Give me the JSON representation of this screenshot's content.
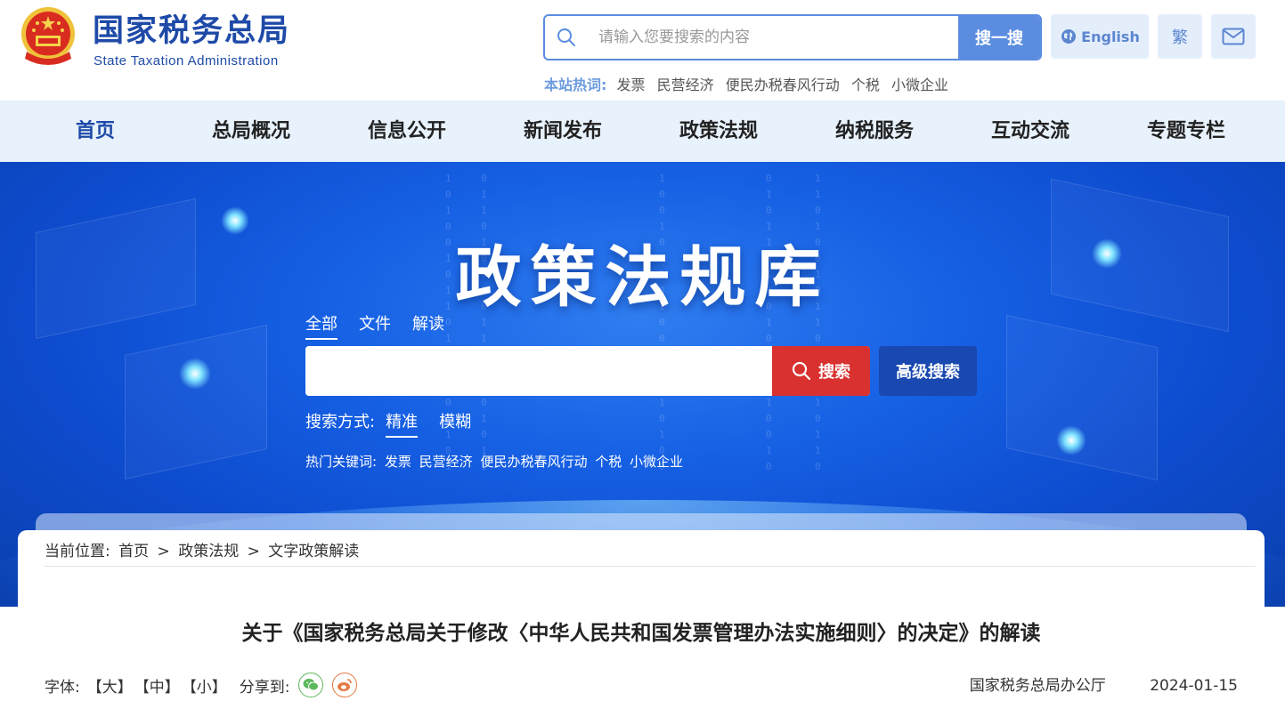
{
  "header": {
    "site_name_cn": "国家税务总局",
    "site_name_en": "State Taxation Administration",
    "search_placeholder": "请输入您要搜索的内容",
    "search_button": "搜一搜",
    "hot_label": "本站热词:",
    "hot_words": [
      "发票",
      "民营经济",
      "便民办税春风行动",
      "个税",
      "小微企业"
    ],
    "english_label": "English",
    "traditional_label": "繁"
  },
  "nav": {
    "items": [
      {
        "label": "首页",
        "active": true
      },
      {
        "label": "总局概况"
      },
      {
        "label": "信息公开"
      },
      {
        "label": "新闻发布"
      },
      {
        "label": "政策法规"
      },
      {
        "label": "纳税服务"
      },
      {
        "label": "互动交流"
      },
      {
        "label": "专题专栏"
      }
    ]
  },
  "banner": {
    "title": "政策法规库",
    "tabs": [
      {
        "label": "全部",
        "active": true
      },
      {
        "label": "文件"
      },
      {
        "label": "解读"
      }
    ],
    "search_button": "搜索",
    "advanced_button": "高级搜索",
    "mode_label": "搜索方式:",
    "modes": [
      {
        "label": "精准",
        "active": true
      },
      {
        "label": "模糊"
      }
    ],
    "hot_label": "热门关键词:",
    "hot_words": [
      "发票",
      "民营经济",
      "便民办税春风行动",
      "个税",
      "小微企业"
    ]
  },
  "content": {
    "breadcrumb_label": "当前位置:",
    "breadcrumb": [
      "首页",
      "政策法规",
      "文字政策解读"
    ],
    "breadcrumb_sep": ">",
    "title": "关于《国家税务总局关于修改〈中华人民共和国发票管理办法实施细则〉的决定》的解读",
    "font_label": "字体:",
    "font_sizes": [
      "【大】",
      "【中】",
      "【小】"
    ],
    "share_label": "分享到:",
    "source": "国家税务总局办公厅",
    "date": "2024-01-15"
  },
  "colors": {
    "brand_blue": "#1e4aa8",
    "nav_bg": "#e8f2fd",
    "search_red": "#d8312f",
    "advanced_blue": "#1848b0"
  }
}
